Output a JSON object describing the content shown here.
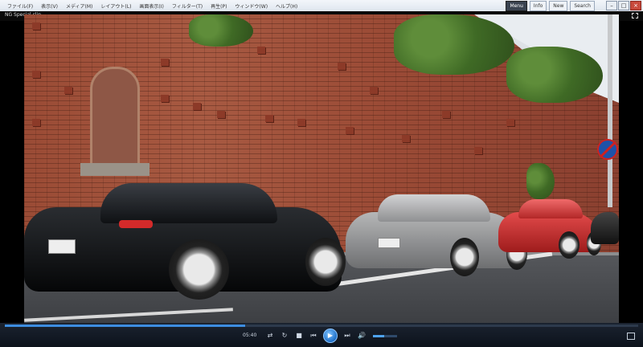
{
  "menu": {
    "items": [
      "ファイル(F)",
      "表示(V)",
      "メディア(M)",
      "レイアウト(L)",
      "画面表示(I)",
      "フィルター(T)",
      "再生(P)",
      "ウィンドウ(W)",
      "ヘルプ(H)"
    ],
    "right": [
      "Menu",
      "Info",
      "New"
    ],
    "search_label": "Search"
  },
  "player": {
    "title": "NG Special clip",
    "time": "05:40",
    "progress_fraction": 0.38,
    "volume_fraction": 0.45
  },
  "icons": {
    "minimize": "minimize-icon",
    "maximize": "maximize-icon",
    "close": "close-icon",
    "fullscreen": "fullscreen-icon",
    "shuffle": "shuffle-icon",
    "repeat": "repeat-icon",
    "stop": "stop-icon",
    "previous": "previous-icon",
    "play": "play-icon",
    "next": "next-icon",
    "volume": "volume-icon",
    "switch_view": "switch-view-icon"
  },
  "colors": {
    "accent": "#3d8de0"
  }
}
